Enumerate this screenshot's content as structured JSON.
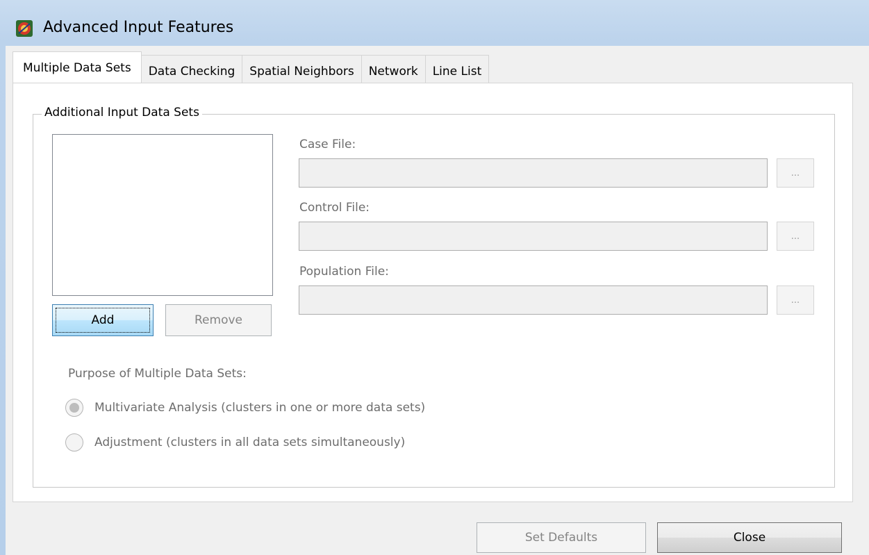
{
  "window": {
    "title": "Advanced Input Features"
  },
  "tabs": [
    {
      "label": "Multiple Data Sets",
      "active": true
    },
    {
      "label": "Data Checking",
      "active": false
    },
    {
      "label": "Spatial Neighbors",
      "active": false
    },
    {
      "label": "Network",
      "active": false
    },
    {
      "label": "Line List",
      "active": false
    }
  ],
  "group": {
    "title": "Additional Input Data Sets",
    "add_label": "Add",
    "remove_label": "Remove",
    "case_file_label": "Case File:",
    "case_file_value": "",
    "control_file_label": "Control File:",
    "control_file_value": "",
    "population_file_label": "Population File:",
    "population_file_value": "",
    "browse_label": "...",
    "purpose_label": "Purpose of Multiple Data Sets:",
    "radio_multivariate": "Multivariate Analysis (clusters in one or more data sets)",
    "radio_adjustment": "Adjustment (clusters in all data sets simultaneously)"
  },
  "footer": {
    "set_defaults_label": "Set Defaults",
    "close_label": "Close"
  },
  "colors": {
    "title_bar": "#c9dcf0",
    "disabled_text": "#6d6d6d",
    "focus_button_border": "#3c7fb1"
  }
}
